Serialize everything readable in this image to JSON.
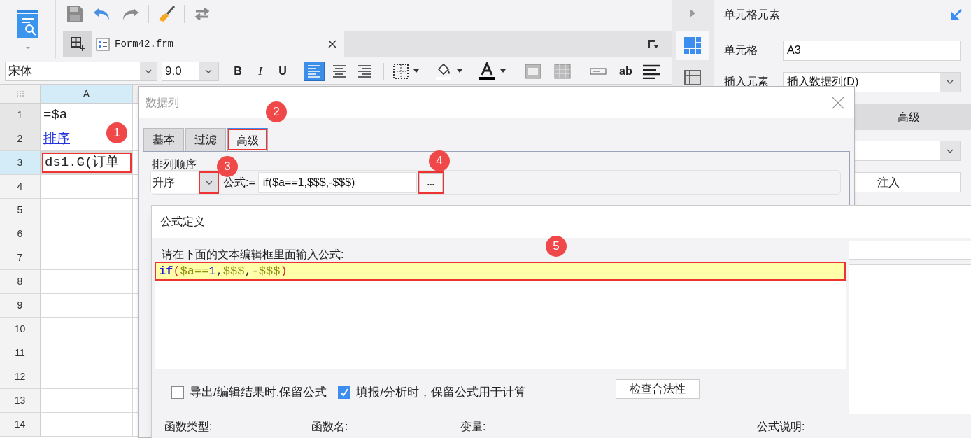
{
  "file_tab": {
    "label": "Form42.frm"
  },
  "format_bar": {
    "font": "宋体",
    "size": "9.0",
    "style_buttons": [
      {
        "text": "B",
        "kind": "bold"
      },
      {
        "text": "I",
        "kind": "italic"
      },
      {
        "text": "U",
        "kind": "underline"
      }
    ],
    "label_button": "ab",
    "alignment": [
      {
        "selected": true
      },
      {
        "selected": false
      },
      {
        "selected": false
      }
    ]
  },
  "sheet": {
    "column_header": "A",
    "rows": [
      {
        "number": "1",
        "cell": "=$a",
        "kind": "text",
        "selected": false,
        "annotated": false
      },
      {
        "number": "2",
        "cell": "排序",
        "kind": "link",
        "selected": false,
        "annotated": false
      },
      {
        "number": "3",
        "cell": "ds1.G(订单",
        "kind": "text",
        "selected": true,
        "annotated": true
      },
      {
        "number": "4"
      },
      {
        "number": "5"
      },
      {
        "number": "6"
      },
      {
        "number": "7"
      },
      {
        "number": "8"
      },
      {
        "number": "9"
      },
      {
        "number": "10"
      },
      {
        "number": "11"
      },
      {
        "number": "12"
      },
      {
        "number": "13"
      },
      {
        "number": "14"
      }
    ]
  },
  "right_panel": {
    "title": "单元格元素",
    "cell_label": "单元格",
    "cell_value": "A3",
    "insert_label": "插入元素",
    "insert_value": "插入数据列(D)",
    "tab": "高级",
    "inject_value": "注入"
  },
  "data_column_dialog": {
    "title": "数据列",
    "tabs": [
      {
        "label": "基本",
        "selected": false,
        "annotated": false
      },
      {
        "label": "过滤",
        "selected": false,
        "annotated": false
      },
      {
        "label": "高级",
        "selected": true,
        "annotated": true
      }
    ],
    "sort_group": "排列顺序",
    "sort_order": "升序",
    "dropdown_annotated": true,
    "formula_label": "公式:=",
    "formula": "if($a==1,$$$,-$$$)",
    "more_button": "...",
    "more_annotated": true
  },
  "formula_dialog": {
    "title": "公式定义",
    "prompt": "请在下面的文本编辑框里面输入公式:",
    "line_annotated": true,
    "tokens": [
      {
        "text": "if",
        "kind": "keyword"
      },
      {
        "text": "(",
        "kind": "paren"
      },
      {
        "text": "$a==",
        "kind": "operand"
      },
      {
        "text": "1",
        "kind": "number"
      },
      {
        "text": ",",
        "kind": "punct"
      },
      {
        "text": "$$$",
        "kind": "operand"
      },
      {
        "text": ",-",
        "kind": "punct"
      },
      {
        "text": "$$$",
        "kind": "operand"
      },
      {
        "text": ")",
        "kind": "paren"
      }
    ],
    "checkboxes": [
      {
        "label": "导出/编辑结果时,保留公式",
        "checked": false
      },
      {
        "label": "填报/分析时，保留公式用于计算",
        "checked": true
      }
    ],
    "check_button": "检查合法性",
    "columns": [
      "函数类型:",
      "函数名:",
      "变量:",
      "公式说明:"
    ]
  },
  "annotations": [
    "1",
    "2",
    "3",
    "4",
    "5"
  ]
}
